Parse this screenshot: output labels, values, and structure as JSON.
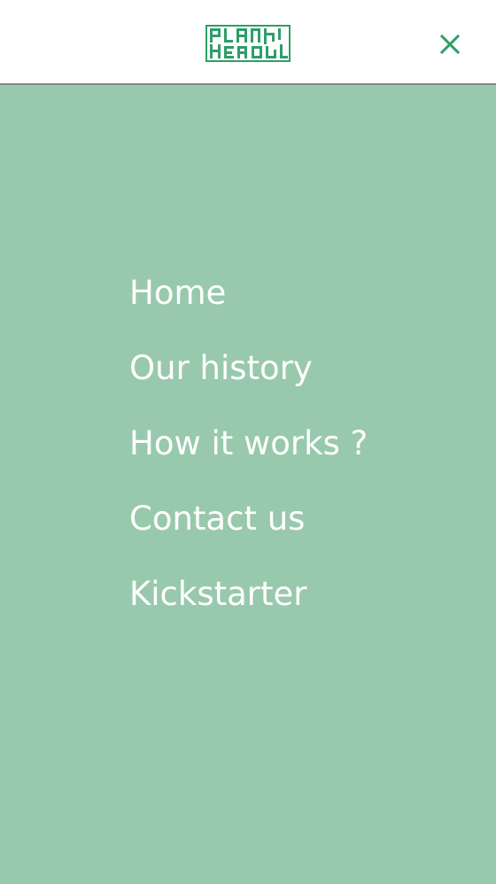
{
  "header": {
    "logo_text": "PLANT HERO",
    "close_icon": "close-icon"
  },
  "menu": {
    "items": [
      {
        "label": "Home"
      },
      {
        "label": "Our history"
      },
      {
        "label": "How it works ?"
      },
      {
        "label": "Contact us"
      },
      {
        "label": "Kickstarter"
      }
    ]
  },
  "colors": {
    "accent": "#2f9e67",
    "menu_background": "#99c9ac",
    "header_background": "#ffffff",
    "menu_text": "#ffffff"
  }
}
